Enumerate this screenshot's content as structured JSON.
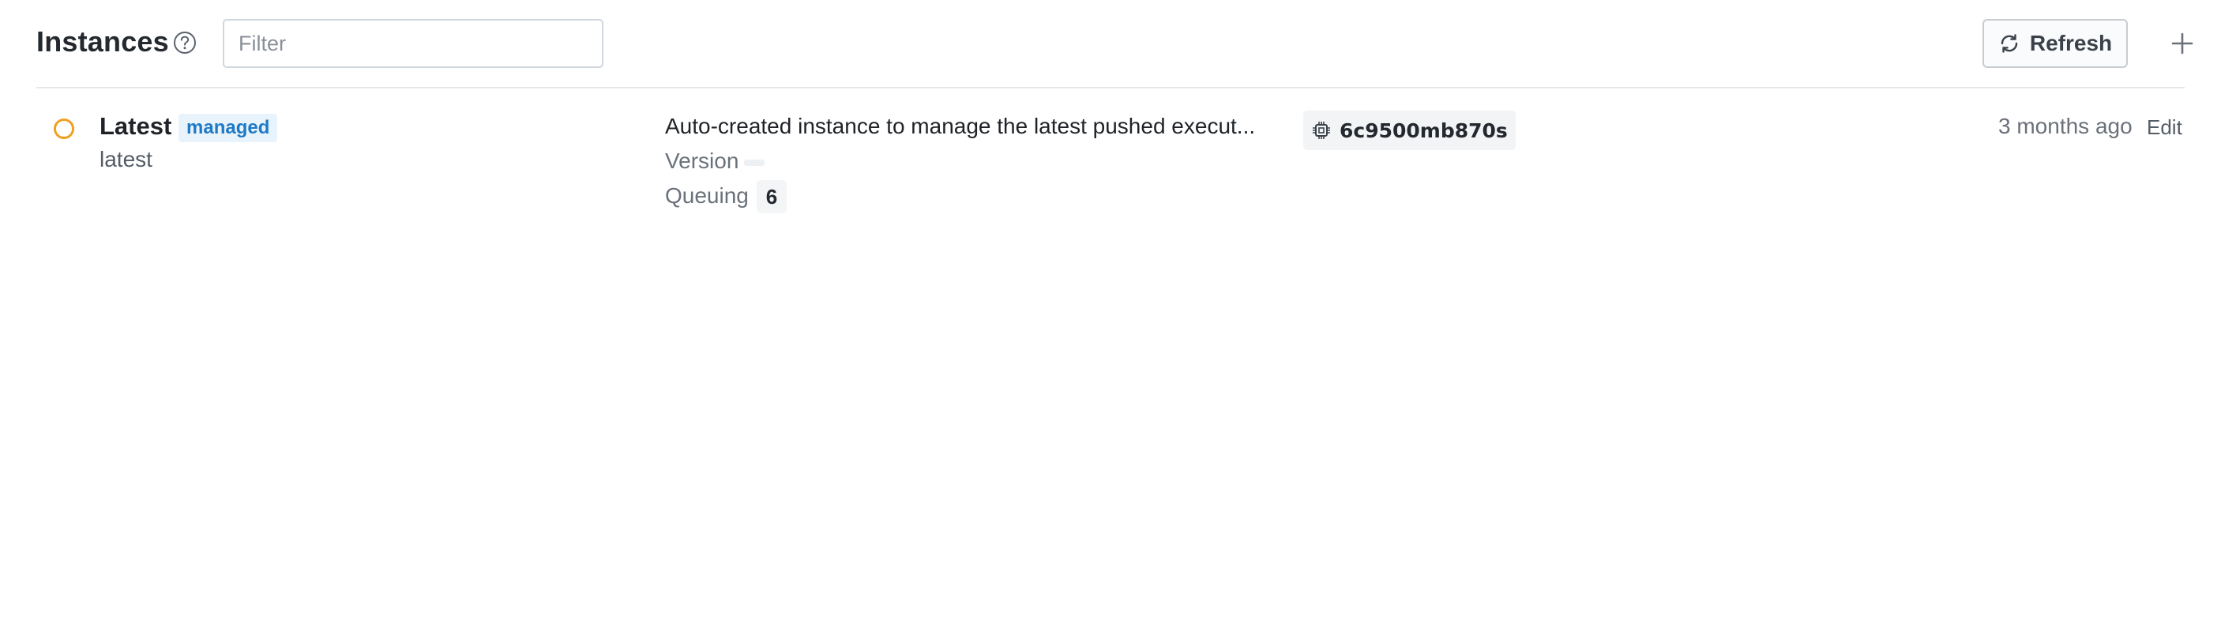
{
  "header": {
    "title": "Instances",
    "help_icon": "question-circle-icon",
    "filter_placeholder": "Filter",
    "filter_value": "",
    "refresh_label": "Refresh",
    "refresh_icon": "refresh-icon",
    "add_icon": "plus-icon"
  },
  "instances": [
    {
      "status_icon": "circle-outline-icon",
      "status_color": "#f0a020",
      "name": "Latest",
      "badge": "managed",
      "slug": "latest",
      "description": "Auto-created instance to manage the latest pushed execut...",
      "version_label": "Version",
      "version_value": "",
      "queuing_label": "Queuing",
      "queuing_value": "6",
      "hash_icon": "chip-icon",
      "hash": "6c9500mb870s",
      "updated": "3 months ago",
      "edit_label": "Edit"
    }
  ],
  "colors": {
    "badge_text": "#1f7ac6",
    "badge_bg": "#e8f3fc",
    "status_pending": "#f0a020"
  }
}
